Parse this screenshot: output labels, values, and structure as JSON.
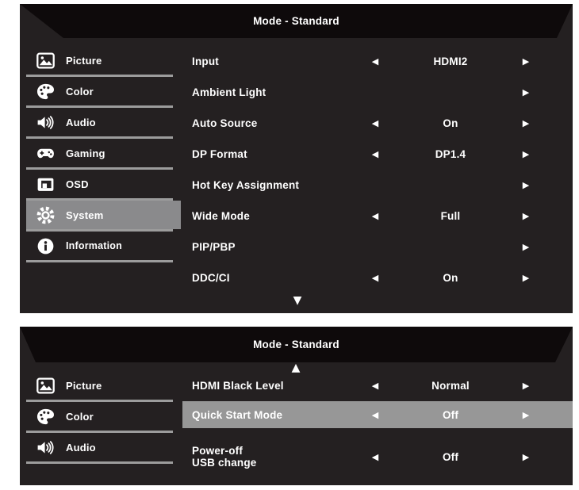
{
  "icons": {
    "left": "◀",
    "right": "▶",
    "up": "▲",
    "down": "▼"
  },
  "colors": {
    "page_bg": "#ffffff",
    "panel_bg": "#242021",
    "header_bg": "#0e0a0b",
    "text": "#ffffff",
    "separator": "#9c9c9c",
    "sidebar_active_bg": "#8a8a8c",
    "row_highlight_bg": "#979797"
  },
  "panels": [
    {
      "title": "Mode - Standard",
      "sidebar": [
        {
          "label": "Picture"
        },
        {
          "label": "Color"
        },
        {
          "label": "Audio"
        },
        {
          "label": "Gaming"
        },
        {
          "label": "OSD"
        },
        {
          "label": "System",
          "active": true
        },
        {
          "label": "Information"
        }
      ],
      "rows": [
        {
          "label": "Input",
          "value": "HDMI2"
        },
        {
          "label": "Ambient Light",
          "value": ""
        },
        {
          "label": "Auto Source",
          "value": "On"
        },
        {
          "label": "DP Format",
          "value": "DP1.4"
        },
        {
          "label": "Hot Key Assignment",
          "value": ""
        },
        {
          "label": "Wide Mode",
          "value": "Full"
        },
        {
          "label": "PIP/PBP",
          "value": ""
        },
        {
          "label": "DDC/CI",
          "value": "On"
        }
      ],
      "scroll_down": true
    },
    {
      "title": "Mode - Standard",
      "scroll_up": true,
      "sidebar": [
        {
          "label": "Picture"
        },
        {
          "label": "Color"
        },
        {
          "label": "Audio"
        }
      ],
      "rows": [
        {
          "label": "HDMI Black Level",
          "value": "Normal"
        },
        {
          "label": "Quick Start Mode",
          "value": "Off",
          "highlighted": true
        },
        {
          "label_line1": "Power-off",
          "label_line2": "USB change",
          "value": "Off"
        }
      ]
    }
  ]
}
